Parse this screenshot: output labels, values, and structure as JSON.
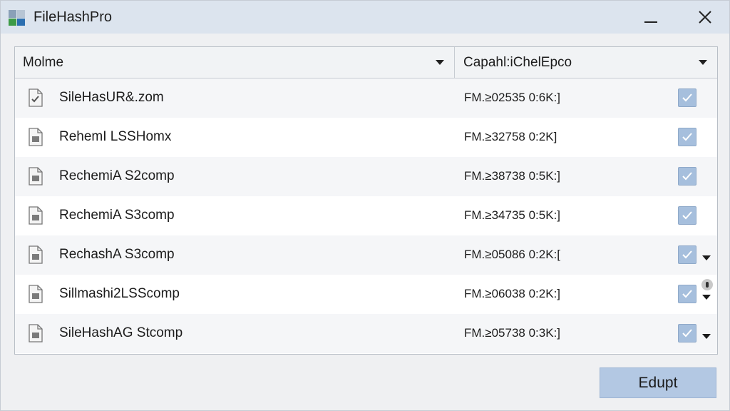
{
  "window": {
    "title": "FileHashPro"
  },
  "columns": {
    "name_header": "Molme",
    "hash_header": "Capahl:iChelEpco"
  },
  "rows": [
    {
      "name": "SileHasUR&.zom",
      "hash": "FM.≥02535 0:6K:]",
      "checked": true,
      "icon": "file-check-icon",
      "menu": false,
      "info": false
    },
    {
      "name": "RehemI LSSHomx",
      "hash": "FM.≥32758 0:2K]",
      "checked": true,
      "icon": "file-doc-icon",
      "menu": false,
      "info": false
    },
    {
      "name": "RechemiA S2comp",
      "hash": "FM.≥38738 0:5K:]",
      "checked": true,
      "icon": "file-doc-icon",
      "menu": false,
      "info": false
    },
    {
      "name": "RechemiA S3comp",
      "hash": "FM.≥34735 0:5K:]",
      "checked": true,
      "icon": "file-doc-icon",
      "menu": false,
      "info": false
    },
    {
      "name": "RechashA S3comp",
      "hash": "FM.≥05086 0:2K:[",
      "checked": true,
      "icon": "file-doc-icon",
      "menu": true,
      "info": false
    },
    {
      "name": "Sillmashi2LSScomp",
      "hash": "FM.≥06038 0:2K:]",
      "checked": true,
      "icon": "file-doc-icon",
      "menu": true,
      "info": true
    },
    {
      "name": "SileHashAG Stcomp",
      "hash": "FM.≥05738 0:3K:]",
      "checked": true,
      "icon": "file-doc-icon",
      "menu": true,
      "info": false
    }
  ],
  "footer": {
    "action_label": "Edupt"
  },
  "colors": {
    "titlebar": "#dce4ee",
    "checkbox": "#a6bfdd",
    "button": "#b3c8e3"
  }
}
